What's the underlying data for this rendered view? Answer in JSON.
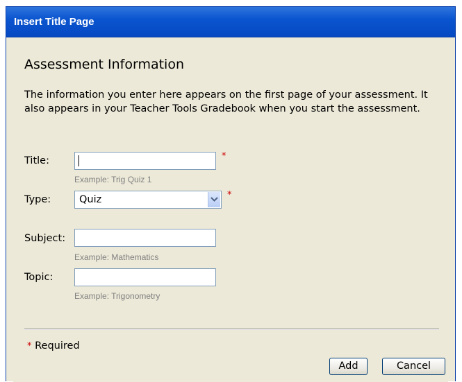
{
  "window": {
    "title": "Insert Title Page"
  },
  "form": {
    "heading": "Assessment Information",
    "intro": "The information you enter here appears on the first page of your assessment. It also appears in your Teacher Tools Gradebook when you start the assessment.",
    "title": {
      "label": "Title:",
      "value": "",
      "hint": "Example: Trig Quiz 1",
      "required_mark": "*"
    },
    "type": {
      "label": "Type:",
      "selected": "Quiz",
      "required_mark": "*"
    },
    "subject": {
      "label": "Subject:",
      "value": "",
      "hint": "Example: Mathematics"
    },
    "topic": {
      "label": "Topic:",
      "value": "",
      "hint": "Example: Trigonometry"
    }
  },
  "footer": {
    "required_star": "*",
    "required_text": " Required",
    "add_label": "Add",
    "cancel_label": "Cancel"
  },
  "colors": {
    "titlebar": "#0b55d0",
    "panel": "#ece9d8",
    "required": "#cc0000",
    "hint": "#808080"
  }
}
